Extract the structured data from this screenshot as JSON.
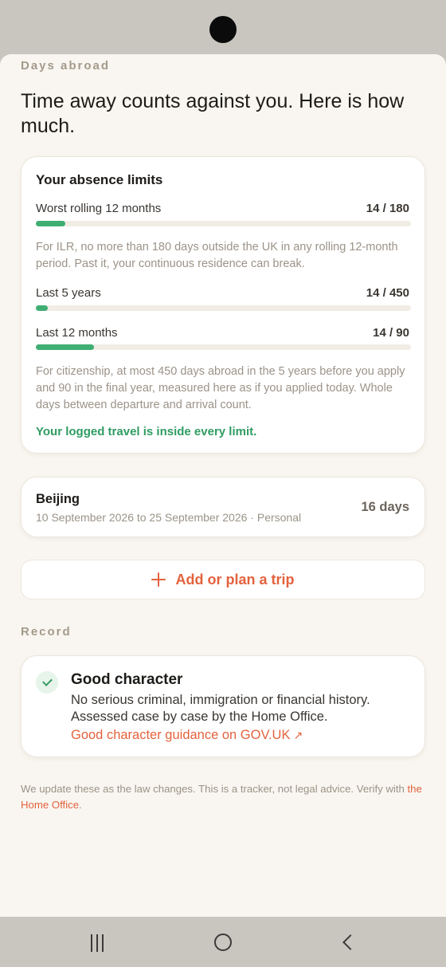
{
  "section_days": "Days abroad",
  "headline": "Time away counts against you. Here is how much.",
  "limits": {
    "title": "Your absence limits",
    "items": [
      {
        "label": "Worst rolling 12 months",
        "value": "14 / 180",
        "fraction": 0.078
      },
      {
        "label": "Last 5 years",
        "value": "14 / 450",
        "fraction": 0.031
      },
      {
        "label": "Last 12 months",
        "value": "14 / 90",
        "fraction": 0.156
      }
    ],
    "ilr_note": "For ILR, no more than 180 days outside the UK in any rolling 12-month period. Past it, your continuous residence can break.",
    "citizenship_note": "For citizenship, at most 450 days abroad in the 5 years before you apply and 90 in the final year, measured here as if you applied today. Whole days between departure and arrival count.",
    "status": "Your logged travel is inside every limit."
  },
  "trip": {
    "city": "Beijing",
    "dates": "10 September 2026 to 25 September 2026 · Personal",
    "days": "16 days"
  },
  "add_trip_label": "Add or plan a trip",
  "section_record": "Record",
  "record": {
    "title": "Good character",
    "description": "No serious criminal, immigration or financial history. Assessed case by case by the Home Office.",
    "link": "Good character guidance on GOV.UK",
    "link_icon": "↗"
  },
  "disclaimer": {
    "text": "We update these as the law changes. This is a tracker, not legal advice. Verify with ",
    "link": "the Home Office",
    "end": "."
  },
  "colors": {
    "accent": "#e3623d",
    "success": "#3fae73",
    "background": "#f9f6f1"
  },
  "icons": [
    "plus-icon",
    "check-icon",
    "external-link-icon",
    "recents-icon",
    "home-icon",
    "back-icon"
  ]
}
